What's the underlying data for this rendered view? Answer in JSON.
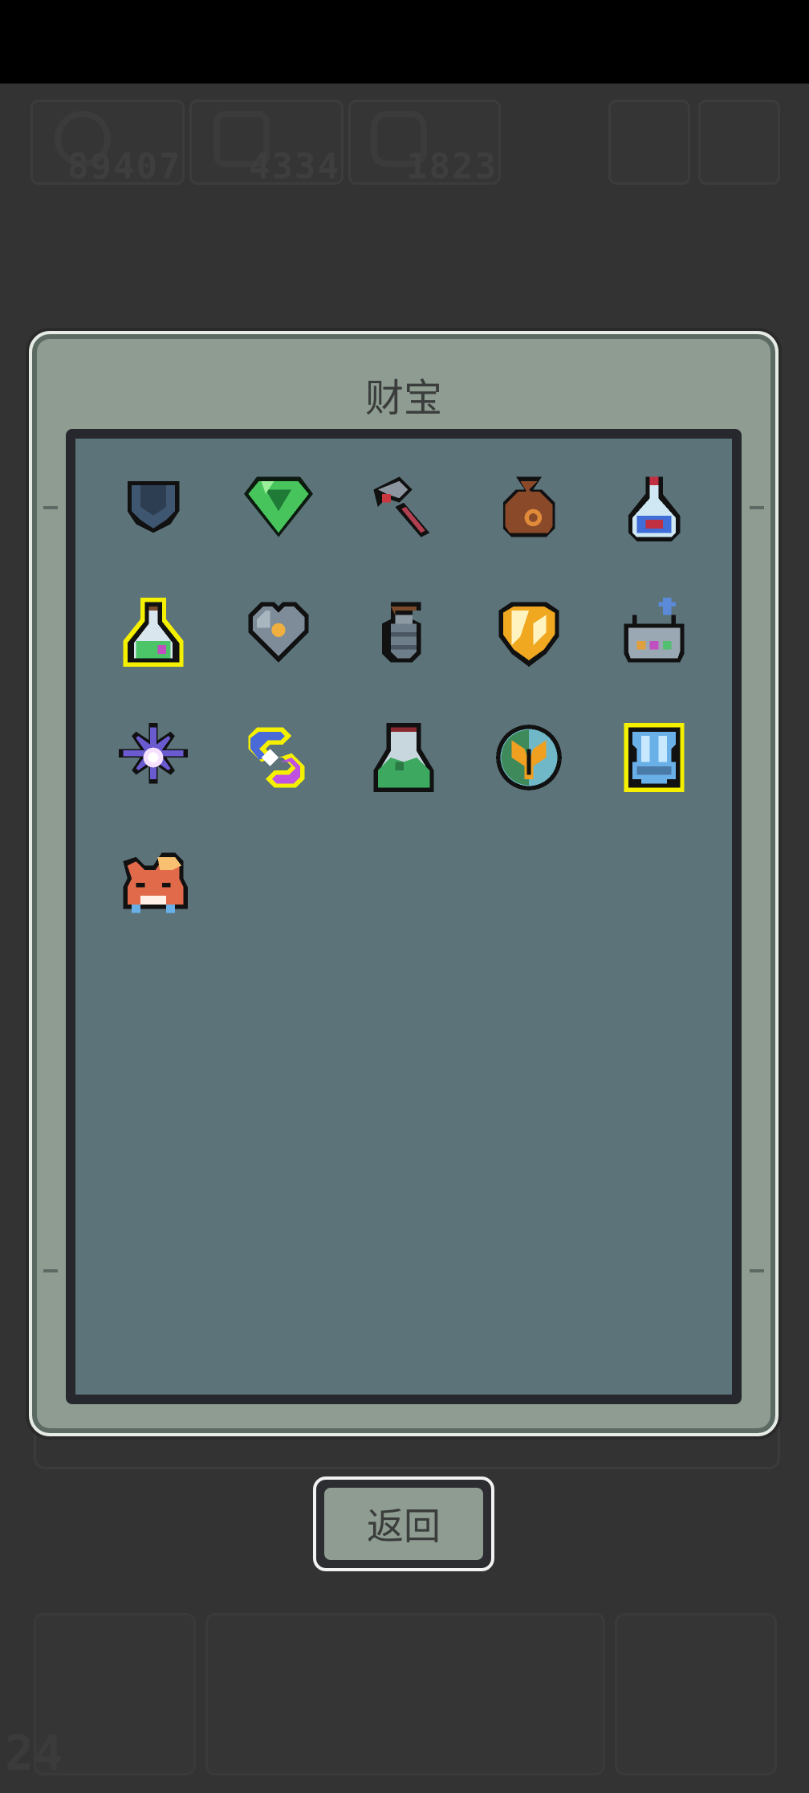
{
  "hud": {
    "counters": [
      "89407",
      "4334",
      "1823"
    ]
  },
  "treasure": {
    "title": "财宝",
    "items": [
      {
        "name": "pocket-icon"
      },
      {
        "name": "green-gem-icon"
      },
      {
        "name": "hammer-icon"
      },
      {
        "name": "money-bag-icon"
      },
      {
        "name": "blue-potion-icon"
      },
      {
        "name": "green-potion-icon"
      },
      {
        "name": "metal-heart-icon"
      },
      {
        "name": "grenade-icon"
      },
      {
        "name": "golden-shield-icon"
      },
      {
        "name": "basket-icon"
      },
      {
        "name": "purple-star-icon"
      },
      {
        "name": "purple-crescent-icon"
      },
      {
        "name": "green-flask-icon"
      },
      {
        "name": "butterfly-orb-icon"
      },
      {
        "name": "blue-armor-icon"
      },
      {
        "name": "fox-head-icon"
      }
    ]
  },
  "back_button": {
    "label": "返回"
  },
  "bottom": {
    "level": "24"
  },
  "colors": {
    "panel": "#8e9c92",
    "inner": "#5c737a",
    "background": "#333333",
    "highlight": "#f4f000"
  }
}
